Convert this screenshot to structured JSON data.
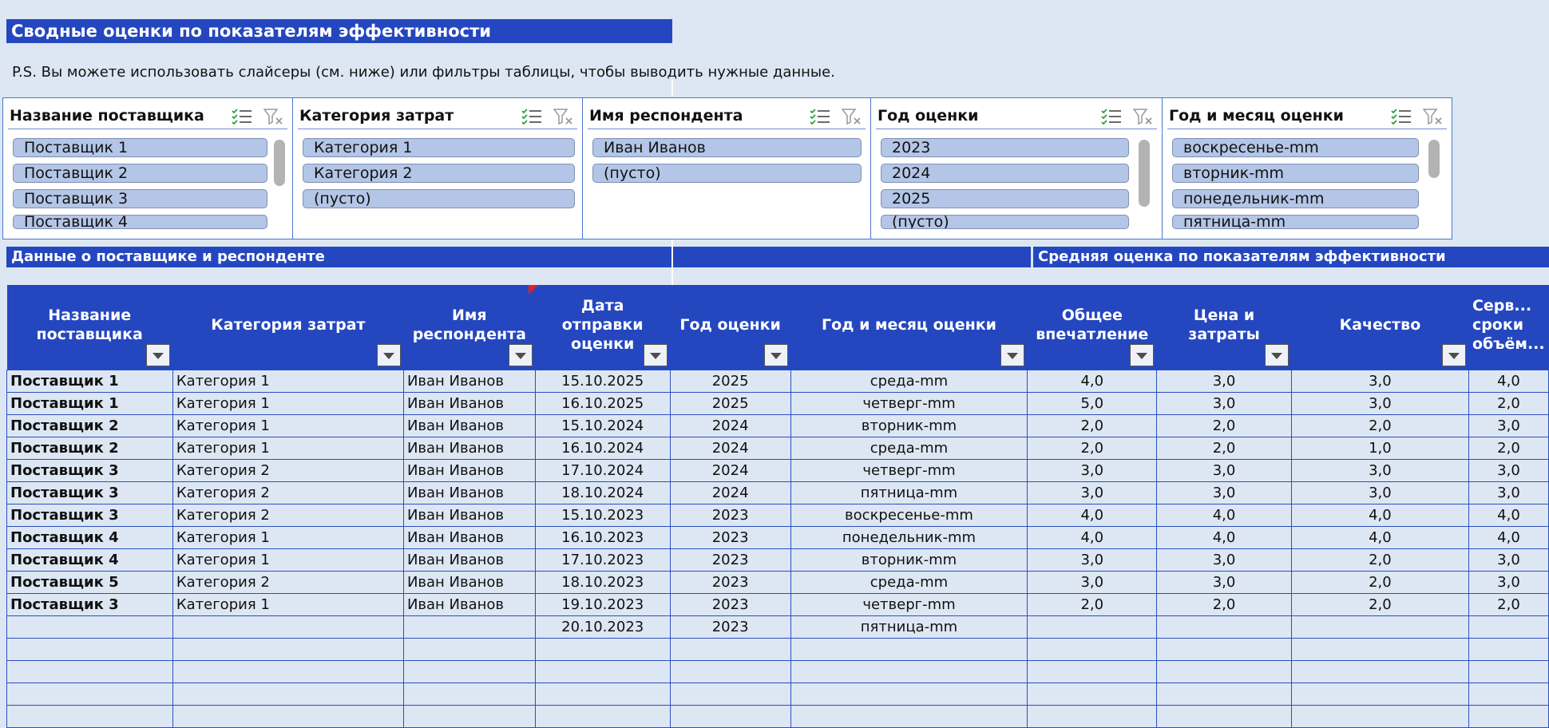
{
  "title": "Сводные оценки по показателям эффективности",
  "note": "P.S. Вы можете использовать слайсеры (см. ниже) или фильтры таблицы, чтобы выводить нужные данные.",
  "slicers": [
    {
      "title": "Название поставщика",
      "items": [
        "Поставщик 1",
        "Поставщик 2",
        "Поставщик 3",
        "Поставщик 4"
      ]
    },
    {
      "title": "Категория затрат",
      "items": [
        "Категория 1",
        "Категория 2",
        "(пусто)"
      ]
    },
    {
      "title": "Имя респондента",
      "items": [
        "Иван Иванов",
        "(пусто)"
      ]
    },
    {
      "title": "Год оценки",
      "items": [
        "2023",
        "2024",
        "2025",
        "(пусто)"
      ]
    },
    {
      "title": "Год и месяц оценки",
      "items": [
        "воскресенье-mm",
        "вторник-mm",
        "понедельник-mm",
        "пятница-mm"
      ]
    }
  ],
  "sections": {
    "left": "Данные о поставщике и респонденте",
    "right": "Средняя оценка по показателям эффективности"
  },
  "table": {
    "headers": [
      "Название поставщика",
      "Категория затрат",
      "Имя респондента",
      "Дата отправки оценки",
      "Год оценки",
      "Год и месяц оценки",
      "Общее впечатление",
      "Цена и затраты",
      "Качество",
      "Серв... сроки объём..."
    ],
    "rows": [
      [
        "Поставщик 1",
        "Категория 1",
        "Иван Иванов",
        "15.10.2025",
        "2025",
        "среда-mm",
        "4,0",
        "3,0",
        "3,0",
        "4,0"
      ],
      [
        "Поставщик 1",
        "Категория 1",
        "Иван Иванов",
        "16.10.2025",
        "2025",
        "четверг-mm",
        "5,0",
        "3,0",
        "3,0",
        "2,0"
      ],
      [
        "Поставщик 2",
        "Категория 1",
        "Иван Иванов",
        "15.10.2024",
        "2024",
        "вторник-mm",
        "2,0",
        "2,0",
        "2,0",
        "3,0"
      ],
      [
        "Поставщик 2",
        "Категория 1",
        "Иван Иванов",
        "16.10.2024",
        "2024",
        "среда-mm",
        "2,0",
        "2,0",
        "1,0",
        "2,0"
      ],
      [
        "Поставщик 3",
        "Категория 2",
        "Иван Иванов",
        "17.10.2024",
        "2024",
        "четверг-mm",
        "3,0",
        "3,0",
        "3,0",
        "3,0"
      ],
      [
        "Поставщик 3",
        "Категория 2",
        "Иван Иванов",
        "18.10.2024",
        "2024",
        "пятница-mm",
        "3,0",
        "3,0",
        "3,0",
        "3,0"
      ],
      [
        "Поставщик 3",
        "Категория 2",
        "Иван Иванов",
        "15.10.2023",
        "2023",
        "воскресенье-mm",
        "4,0",
        "4,0",
        "4,0",
        "4,0"
      ],
      [
        "Поставщик 4",
        "Категория 1",
        "Иван Иванов",
        "16.10.2023",
        "2023",
        "понедельник-mm",
        "4,0",
        "4,0",
        "4,0",
        "4,0"
      ],
      [
        "Поставщик 4",
        "Категория 1",
        "Иван Иванов",
        "17.10.2023",
        "2023",
        "вторник-mm",
        "3,0",
        "3,0",
        "2,0",
        "3,0"
      ],
      [
        "Поставщик 5",
        "Категория 2",
        "Иван Иванов",
        "18.10.2023",
        "2023",
        "среда-mm",
        "3,0",
        "3,0",
        "2,0",
        "3,0"
      ],
      [
        "Поставщик 3",
        "Категория 1",
        "Иван Иванов",
        "19.10.2023",
        "2023",
        "четверг-mm",
        "2,0",
        "2,0",
        "2,0",
        "2,0"
      ],
      [
        "",
        "",
        "",
        "20.10.2023",
        "2023",
        "пятница-mm",
        "",
        "",
        "",
        ""
      ],
      [
        "",
        "",
        "",
        "",
        "",
        "",
        "",
        "",
        "",
        ""
      ],
      [
        "",
        "",
        "",
        "",
        "",
        "",
        "",
        "",
        "",
        ""
      ],
      [
        "",
        "",
        "",
        "",
        "",
        "",
        "",
        "",
        "",
        ""
      ],
      [
        "",
        "",
        "",
        "",
        "",
        "",
        "",
        "",
        "",
        ""
      ]
    ]
  },
  "colors": {
    "accent": "#2447c0",
    "background": "#dde7f3",
    "slicer_item": "#b4c6e7",
    "marker": "#e02020"
  }
}
